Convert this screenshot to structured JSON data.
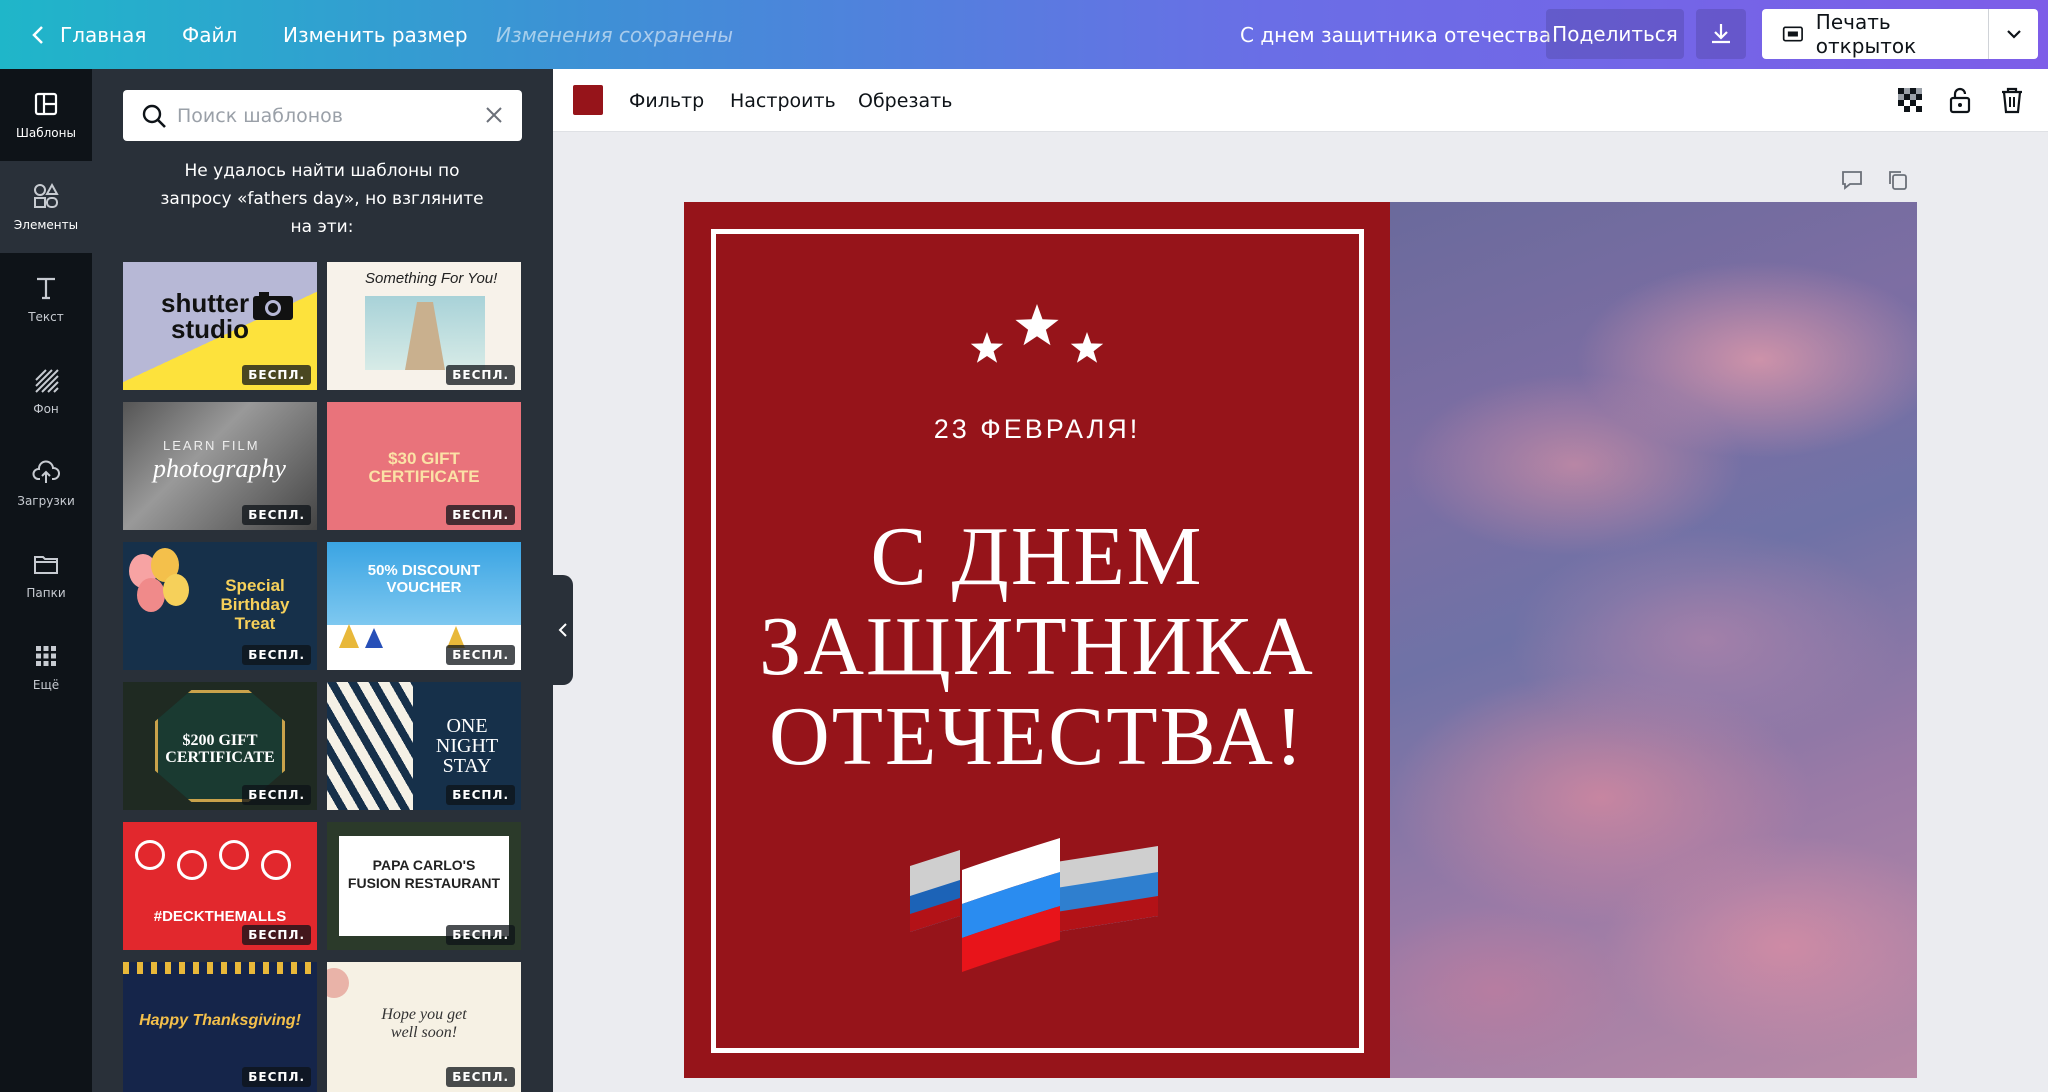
{
  "topbar": {
    "home": "Главная",
    "file": "Файл",
    "resize": "Изменить размер",
    "saved_status": "Изменения сохранены",
    "document_title": "С днем защитника отечества!",
    "share": "Поделиться",
    "print": "Печать открыток"
  },
  "rail": [
    {
      "label": "Шаблоны",
      "icon": "templates-icon"
    },
    {
      "label": "Элементы",
      "icon": "elements-icon"
    },
    {
      "label": "Текст",
      "icon": "text-icon"
    },
    {
      "label": "Фон",
      "icon": "background-icon"
    },
    {
      "label": "Загрузки",
      "icon": "uploads-icon"
    },
    {
      "label": "Папки",
      "icon": "folders-icon"
    },
    {
      "label": "Ещё",
      "icon": "more-icon"
    }
  ],
  "panel": {
    "search_placeholder": "Поиск шаблонов",
    "not_found_message": "Не удалось найти шаблоны по запросу «fathers day», но взгляните на эти:",
    "free_badge": "БЕСПЛ.",
    "templates": [
      {
        "l1": "shutter",
        "l2": "studio"
      },
      {
        "l1": "Something For You!",
        "l2": ""
      },
      {
        "l1": "LEARN FILM",
        "l2": "photography"
      },
      {
        "l1": "$30 GIFT",
        "l2": "CERTIFICATE"
      },
      {
        "l1": "Special",
        "l2": "Birthday",
        "l3": "Treat"
      },
      {
        "l1": "50% DISCOUNT",
        "l2": "VOUCHER"
      },
      {
        "l1": "$200 GIFT",
        "l2": "CERTIFICATE"
      },
      {
        "l1": "ONE",
        "l2": "NIGHT",
        "l3": "STAY"
      },
      {
        "l1": "#DECKTHEMALLS",
        "l2": ""
      },
      {
        "l1": "PAPA CARLO'S",
        "l2": "FUSION RESTAURANT"
      },
      {
        "l1": "Happy Thanksgiving!",
        "l2": ""
      },
      {
        "l1": "Hope you get",
        "l2": "well soon!"
      }
    ]
  },
  "toolbar": {
    "color": "#96141a",
    "filter": "Фильтр",
    "adjust": "Настроить",
    "crop": "Обрезать"
  },
  "design": {
    "date": "23 ФЕВРАЛЯ!",
    "headline_1": "С ДНЕМ",
    "headline_2": "ЗАЩИТНИКА",
    "headline_3": "ОТЕЧЕСТВА!",
    "bg_color": "#96141a"
  }
}
